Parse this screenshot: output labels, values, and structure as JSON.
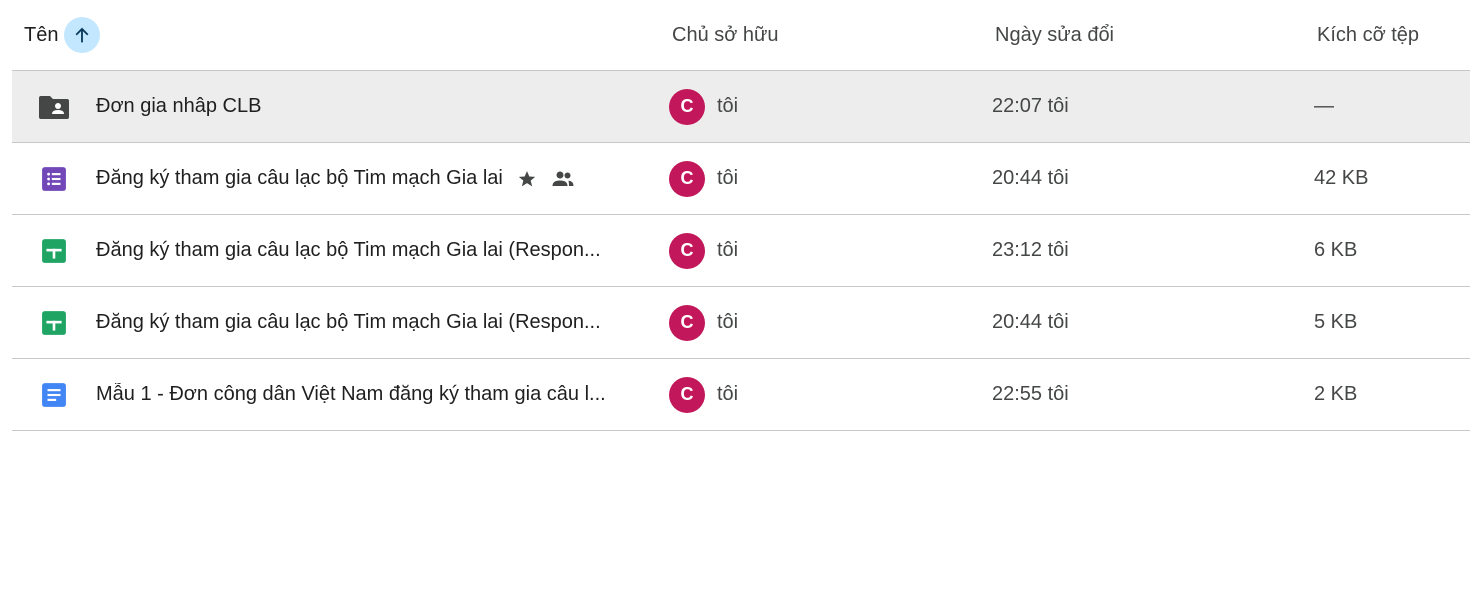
{
  "header": {
    "name_label": "Tên",
    "owner_label": "Chủ sở hữu",
    "date_label": "Ngày sửa đổi",
    "size_label": "Kích cỡ tệp"
  },
  "colors": {
    "sort_button_bg": "#c2e7ff",
    "avatar_bg": "#c2185b",
    "forms": "#7248b9",
    "sheets": "#1fa463",
    "docs": "#4285f4",
    "folder": "#444746",
    "selected_row_bg": "#ededed"
  },
  "rows": [
    {
      "icon": "shared-folder-icon",
      "name": "Đơn gia nhâp CLB",
      "owner_initial": "C",
      "owner": "tôi",
      "modified": "22:07 tôi",
      "size": "—",
      "selected": true
    },
    {
      "icon": "google-forms-icon",
      "name": "Đăng ký tham gia câu lạc bộ Tim mạch Gia lai",
      "owner_initial": "C",
      "owner": "tôi",
      "modified": "20:44 tôi",
      "size": "42 KB",
      "starred": true,
      "shared": true
    },
    {
      "icon": "google-sheets-icon",
      "name": "Đăng ký tham gia câu lạc bộ Tim mạch Gia lai (Respon...",
      "owner_initial": "C",
      "owner": "tôi",
      "modified": "23:12 tôi",
      "size": "6 KB"
    },
    {
      "icon": "google-sheets-icon",
      "name": "Đăng ký tham gia câu lạc bộ Tim mạch Gia lai (Respon...",
      "owner_initial": "C",
      "owner": "tôi",
      "modified": "20:44 tôi",
      "size": "5 KB"
    },
    {
      "icon": "google-docs-icon",
      "name": "Mẫu 1 - Đơn công dân Việt Nam đăng ký tham gia câu l...",
      "owner_initial": "C",
      "owner": "tôi",
      "modified": "22:55 tôi",
      "size": "2 KB"
    }
  ]
}
